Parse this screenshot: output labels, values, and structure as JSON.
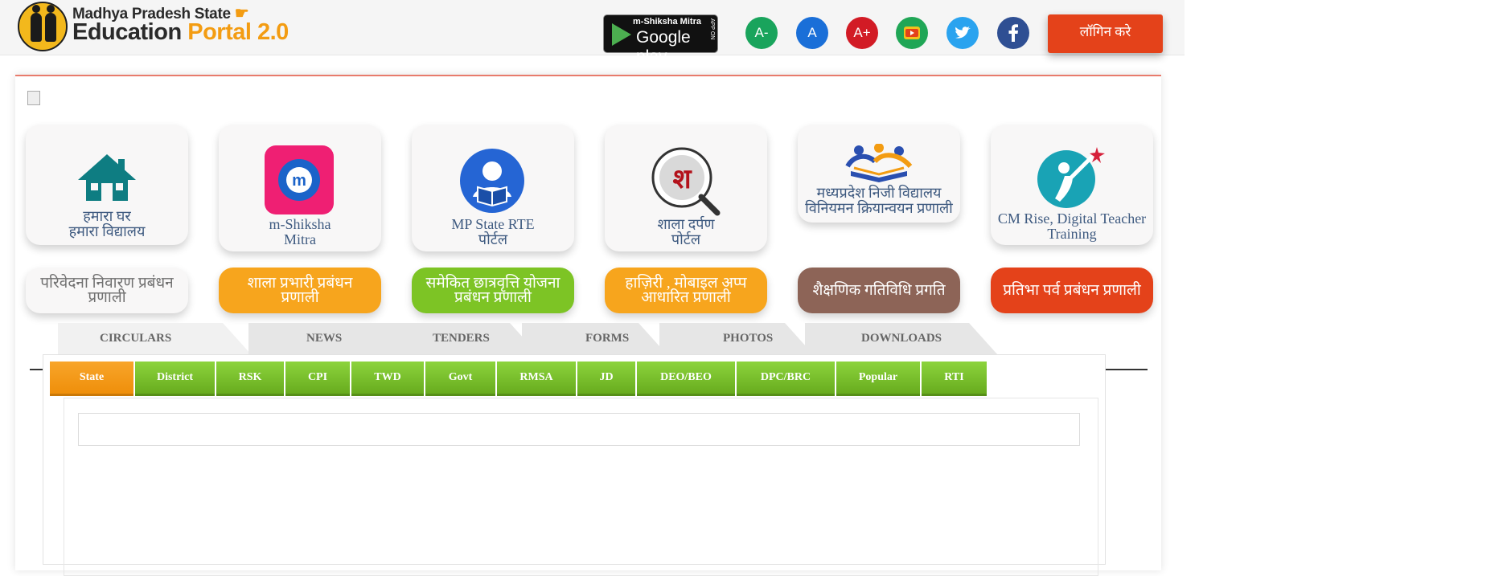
{
  "header": {
    "brand_line1": "Madhya Pradesh State",
    "brand_word1": "Education",
    "brand_word2": "Portal 2.0",
    "app_badge": {
      "top": "m-Shiksha Mitra",
      "main": "Google play",
      "side": "APP ON"
    },
    "font_buttons": [
      {
        "label": "A-",
        "name": "font-decrease-button",
        "color": "#19a45c"
      },
      {
        "label": "A",
        "name": "font-normal-button",
        "color": "#1a6fd8"
      },
      {
        "label": "A+",
        "name": "font-increase-button",
        "color": "#d21b25"
      }
    ],
    "social_icons": [
      {
        "name": "youtube-icon",
        "color": "#20a656"
      },
      {
        "name": "twitter-icon",
        "color": "#2aa3ef"
      },
      {
        "name": "facebook-icon",
        "color": "#2f4f93"
      }
    ],
    "login_label": "लॉगिन करे"
  },
  "cards": [
    {
      "line1": "हमारा घर",
      "line2": "हमारा विद्यालय",
      "icon": "house-icon"
    },
    {
      "line1": "m-Shiksha",
      "line2": "Mitra",
      "icon": "m-shiksha-mitra-icon"
    },
    {
      "line1": "MP State RTE",
      "line2": "पोर्टल",
      "icon": "reader-icon"
    },
    {
      "line1": "शाला दर्पण",
      "line2": "पोर्टल",
      "icon": "shala-darpan-icon"
    },
    {
      "line1": "मध्यप्रदेश निजी विद्यालय",
      "line2": "विनियमन क्रियान्वयन प्रणाली",
      "icon": "school-books-icon"
    },
    {
      "line1": "CM Rise, Digital Teacher",
      "line2": "Training",
      "icon": "cm-rise-icon"
    }
  ],
  "pills": [
    {
      "label": "परिवेदना निवारण प्रबंधन प्रणाली",
      "bg": "#f8f7f7",
      "color": "#707070"
    },
    {
      "label": "शाला प्रभारी प्रबंधन प्रणाली",
      "bg": "#f7a51d",
      "color": "#ffffff"
    },
    {
      "label": "समेकित छात्रवृत्ति योजना प्रबंधन प्रणाली",
      "bg": "#7dc425",
      "color": "#ffffff"
    },
    {
      "label": "हाज़िरी , मोबाइल अप्प आधारित प्रणाली",
      "bg": "#f7a51d",
      "color": "#ffffff"
    },
    {
      "label": "शैक्षणिक गतिविधि प्रगति",
      "bg": "#8d6457",
      "color": "#ffffff"
    },
    {
      "label": "प्रतिभा पर्व प्रबंधन प्रणाली",
      "bg": "#e4421a",
      "color": "#ffffff"
    }
  ],
  "tabs": [
    "CIRCULARS",
    "NEWS",
    "TENDERS",
    "FORMS",
    "PHOTOS",
    "DOWNLOADS"
  ],
  "subtabs": [
    "State",
    "District",
    "RSK",
    "CPI",
    "TWD",
    "Govt",
    "RMSA",
    "JD",
    "DEO/BEO",
    "DPC/BRC",
    "Popular",
    "RTI"
  ],
  "active_subtab": "State"
}
